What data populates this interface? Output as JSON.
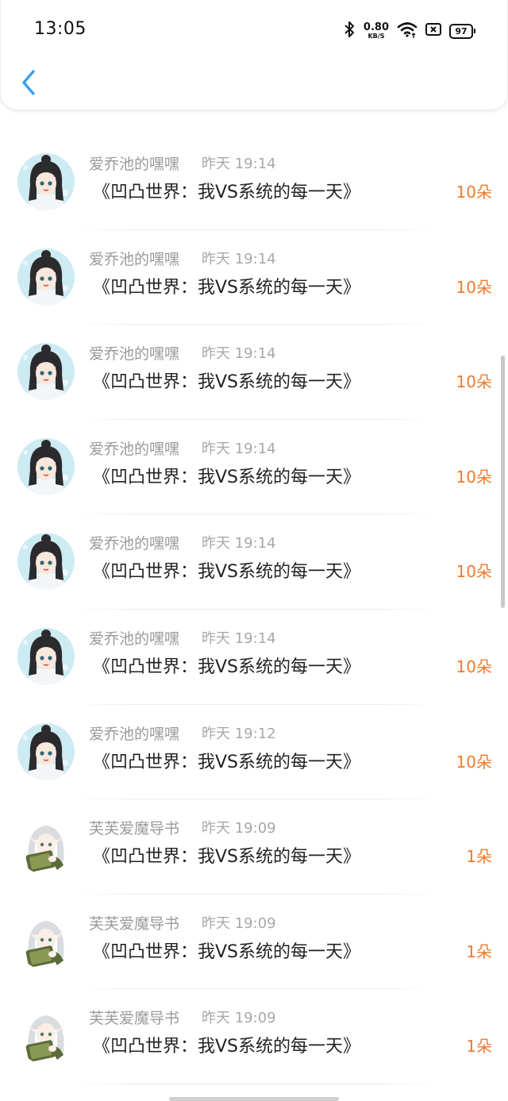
{
  "status_bar": {
    "time": "13:05",
    "net_speed_value": "0.80",
    "net_speed_unit": "KB/S",
    "battery": "97",
    "icons": [
      "bluetooth-icon",
      "wifi-icon",
      "sim-off-icon",
      "battery-icon"
    ]
  },
  "nav": {
    "back_icon": "chevron-left-icon",
    "accent_color": "#3a9ff0"
  },
  "colors": {
    "amount": "#ef7a2c",
    "username": "#9a9a9a",
    "title": "#222222"
  },
  "entries": [
    {
      "user": "爱乔池的嘿嘿",
      "time": "昨天 19:14",
      "title": "《凹凸世界：我VS系统的每一天》",
      "amount": "10朵",
      "avatar": "girl-avatar"
    },
    {
      "user": "爱乔池的嘿嘿",
      "time": "昨天 19:14",
      "title": "《凹凸世界：我VS系统的每一天》",
      "amount": "10朵",
      "avatar": "girl-avatar"
    },
    {
      "user": "爱乔池的嘿嘿",
      "time": "昨天 19:14",
      "title": "《凹凸世界：我VS系统的每一天》",
      "amount": "10朵",
      "avatar": "girl-avatar"
    },
    {
      "user": "爱乔池的嘿嘿",
      "time": "昨天 19:14",
      "title": "《凹凸世界：我VS系统的每一天》",
      "amount": "10朵",
      "avatar": "girl-avatar"
    },
    {
      "user": "爱乔池的嘿嘿",
      "time": "昨天 19:14",
      "title": "《凹凸世界：我VS系统的每一天》",
      "amount": "10朵",
      "avatar": "girl-avatar"
    },
    {
      "user": "爱乔池的嘿嘿",
      "time": "昨天 19:14",
      "title": "《凹凸世界：我VS系统的每一天》",
      "amount": "10朵",
      "avatar": "girl-avatar"
    },
    {
      "user": "爱乔池的嘿嘿",
      "time": "昨天 19:12",
      "title": "《凹凸世界：我VS系统的每一天》",
      "amount": "10朵",
      "avatar": "girl-avatar"
    },
    {
      "user": "芙芙爱魔导书",
      "time": "昨天 19:09",
      "title": "《凹凸世界：我VS系统的每一天》",
      "amount": "1朵",
      "avatar": "elf-book-avatar"
    },
    {
      "user": "芙芙爱魔导书",
      "time": "昨天 19:09",
      "title": "《凹凸世界：我VS系统的每一天》",
      "amount": "1朵",
      "avatar": "elf-book-avatar"
    },
    {
      "user": "芙芙爱魔导书",
      "time": "昨天 19:09",
      "title": "《凹凸世界：我VS系统的每一天》",
      "amount": "1朵",
      "avatar": "elf-book-avatar"
    }
  ]
}
